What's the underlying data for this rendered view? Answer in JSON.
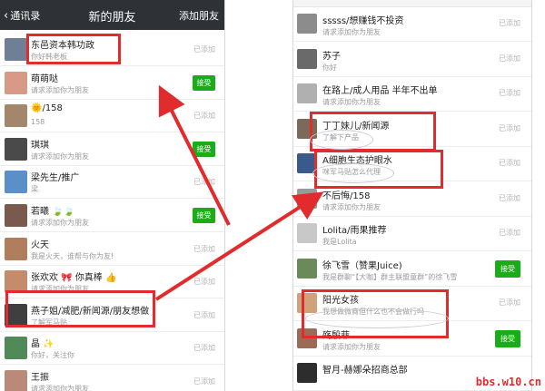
{
  "left": {
    "nav": {
      "back_label": "通讯录",
      "title": "新的朋友",
      "action": "添加朋友"
    },
    "rows": [
      {
        "name": "东邑资本韩功政",
        "msg": "你好韩老板",
        "status": "已添加",
        "avatar_color": "#6e7f96",
        "avatar": "avatar-icon"
      },
      {
        "name": "萌萌哒",
        "msg": "请求添加你为朋友",
        "status": "接受",
        "avatar_color": "#d69a86",
        "avatar": "avatar-icon"
      },
      {
        "name": "🌞/158",
        "msg": "158",
        "status": "已添加",
        "avatar_color": "#a3876b",
        "avatar": "avatar-icon"
      },
      {
        "name": "琪琪",
        "msg": "请求添加你为朋友",
        "status": "接受",
        "avatar_color": "#4a4a4a",
        "avatar": "avatar-icon"
      },
      {
        "name": "梁先生/推广",
        "msg": "梁",
        "status": "已添加",
        "avatar_color": "#5a8fc7",
        "avatar": "avatar-icon"
      },
      {
        "name": "若曦 🍃🍃",
        "msg": "请求添加你为朋友",
        "status": "接受",
        "avatar_color": "#7b5a4e",
        "avatar": "avatar-icon"
      },
      {
        "name": "火天",
        "msg": "我是火天，谁帮与你为友!",
        "status": "已添加",
        "avatar_color": "#b07e5d",
        "avatar": "avatar-icon"
      },
      {
        "name": "张欢欢 🎀 你真棒 👍",
        "msg": "请求添加你为朋友",
        "status": "已添加",
        "avatar_color": "#c58c6b",
        "avatar": "avatar-icon"
      },
      {
        "name": "燕子姐/减肥/新闻源/朋友想做",
        "msg": "了解军马贴",
        "status": "已添加",
        "avatar_color": "#3f3f3f",
        "avatar": "avatar-icon"
      },
      {
        "name": "晶 ✨",
        "msg": "你好，关注你",
        "status": "已添加",
        "avatar_color": "#4f8a58",
        "avatar": "avatar-icon"
      },
      {
        "name": "王振",
        "msg": "请求添加你为朋友",
        "status": "已添加",
        "avatar_color": "#b98a77",
        "avatar": "avatar-icon"
      }
    ]
  },
  "right": {
    "rows": [
      {
        "name": "sssss/想赚钱不投资",
        "msg": "请求添加你为朋友",
        "status": "已添加",
        "avatar_color": "#8c8c8c",
        "avatar": "avatar-icon"
      },
      {
        "name": "苏子",
        "msg": "你好",
        "status": "已添加",
        "avatar_color": "#6a6a6a",
        "avatar": "avatar-icon"
      },
      {
        "name": "在路上/成人用品 半年不出单",
        "msg": "请求添加你为朋友",
        "status": "已添加",
        "avatar_color": "#b0b0b0",
        "avatar": "avatar-icon"
      },
      {
        "name": "丁丁妹儿/新闻源",
        "msg": "了解下产品",
        "status": "已添加",
        "avatar_color": "#7a6a5a",
        "avatar": "avatar-icon"
      },
      {
        "name": "A细胞生态护眼水",
        "msg": "咪军马贴怎么代理",
        "status": "已添加",
        "avatar_color": "#3a5a8c",
        "avatar": "avatar-icon"
      },
      {
        "name": "不后悔/158",
        "msg": "请求添加你为朋友",
        "status": "已添加",
        "avatar_color": "#9a9a9a",
        "avatar": "avatar-icon"
      },
      {
        "name": "Lolita/雨果推荐",
        "msg": "我是Lolita",
        "status": "已添加",
        "avatar_color": "#c8c8c8",
        "avatar": "avatar-icon"
      },
      {
        "name": "徐飞雪（赞果Juice)",
        "msg": "我是群聊“【大咖】群主联盟童群”的徐飞雪",
        "status": "接受",
        "avatar_color": "#6b8a5a",
        "avatar": "avatar-icon"
      },
      {
        "name": "阳光女孩",
        "msg": "我想做微商但什么也不会做行吗",
        "status": "已添加",
        "avatar_color": "#d0a27a",
        "avatar": "avatar-icon"
      },
      {
        "name": "殇殷菲",
        "msg": "请求添加你为朋友",
        "status": "接受",
        "avatar_color": "#9b6b55",
        "avatar": "avatar-icon"
      },
      {
        "name": "智月-赫娜朵招商总部",
        "msg": "",
        "status": "",
        "avatar_color": "#2d2d2d",
        "avatar": "avatar-icon"
      }
    ]
  },
  "colors": {
    "accent_red": "#e02c2c",
    "accept_green": "#1aad19",
    "navbar": "#2e3135"
  },
  "watermark": "bbs.w10.cn"
}
